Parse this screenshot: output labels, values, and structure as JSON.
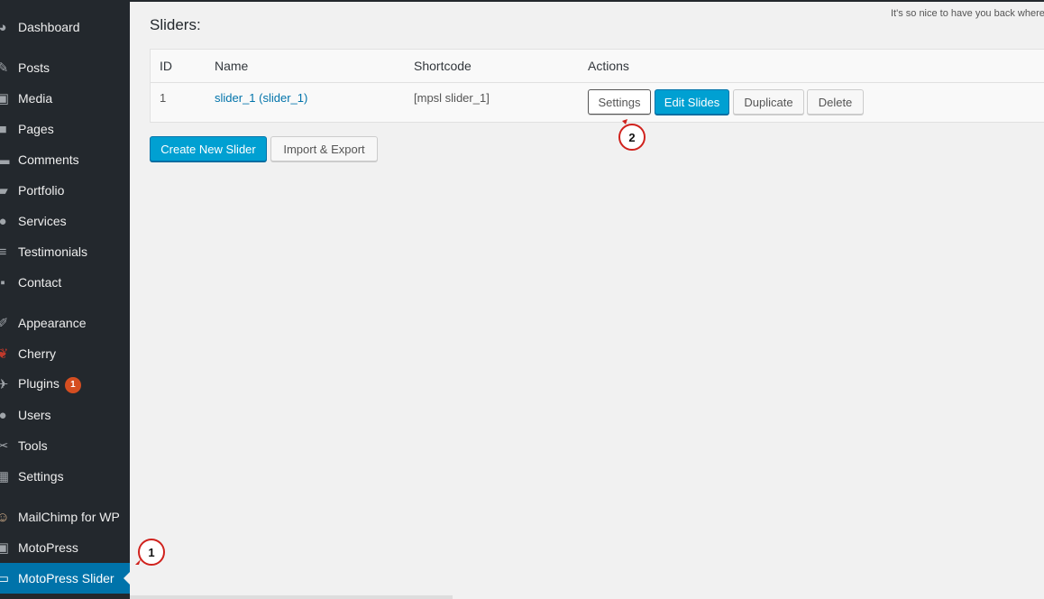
{
  "sidebar": {
    "items": [
      {
        "label": "Dashboard",
        "icon": "dashboard-icon",
        "glyph": "◕"
      },
      {
        "label": "Posts",
        "icon": "pin-icon",
        "glyph": "✎"
      },
      {
        "label": "Media",
        "icon": "media-icon",
        "glyph": "▣"
      },
      {
        "label": "Pages",
        "icon": "pages-icon",
        "glyph": "■"
      },
      {
        "label": "Comments",
        "icon": "comments-icon",
        "glyph": "▬"
      },
      {
        "label": "Portfolio",
        "icon": "portfolio-icon",
        "glyph": "▰"
      },
      {
        "label": "Services",
        "icon": "services-icon",
        "glyph": "●"
      },
      {
        "label": "Testimonials",
        "icon": "testimonials-icon",
        "glyph": "≡"
      },
      {
        "label": "Contact",
        "icon": "contact-icon",
        "glyph": "▪"
      },
      {
        "label": "Appearance",
        "icon": "appearance-icon",
        "glyph": "✐"
      },
      {
        "label": "Cherry",
        "icon": "cherry-icon",
        "glyph": "❦"
      },
      {
        "label": "Plugins",
        "icon": "plugins-icon",
        "glyph": "✈",
        "badge": "1"
      },
      {
        "label": "Users",
        "icon": "users-icon",
        "glyph": "●"
      },
      {
        "label": "Tools",
        "icon": "tools-icon",
        "glyph": "✂"
      },
      {
        "label": "Settings",
        "icon": "settings-icon",
        "glyph": "▦"
      },
      {
        "label": "MailChimp for WP",
        "icon": "mailchimp-icon",
        "glyph": "☺"
      },
      {
        "label": "MotoPress",
        "icon": "motopress-icon",
        "glyph": "▣"
      },
      {
        "label": "MotoPress Slider",
        "icon": "motopress-slider-icon",
        "glyph": "▭",
        "active": true
      }
    ]
  },
  "header": {
    "greeting": "It's so nice to have you back where you belong!"
  },
  "main": {
    "heading": "Sliders:",
    "table": {
      "columns": [
        "ID",
        "Name",
        "Shortcode",
        "Actions"
      ],
      "rows": [
        {
          "id": "1",
          "name": "slider_1 (slider_1)",
          "shortcode": "[mpsl slider_1]"
        }
      ]
    },
    "row_actions": {
      "settings": "Settings",
      "edit_slides": "Edit Slides",
      "duplicate": "Duplicate",
      "delete": "Delete"
    },
    "buttons": {
      "create": "Create New Slider",
      "import_export": "Import & Export"
    }
  },
  "callouts": {
    "one": "1",
    "two": "2"
  },
  "colors": {
    "sidebar_bg": "#23282d",
    "active_bg": "#0073aa",
    "primary_button": "#00a0d2",
    "badge": "#d54e21",
    "callout_border": "#d0221d"
  }
}
